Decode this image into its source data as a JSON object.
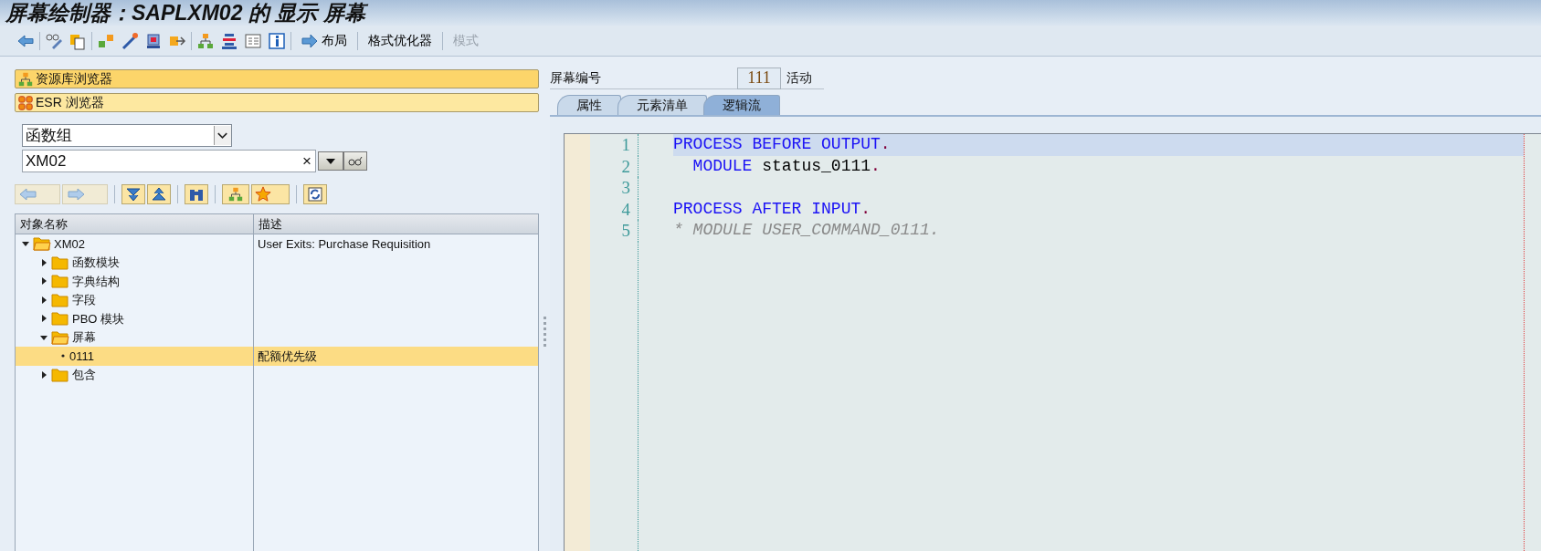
{
  "window": {
    "title": "屏幕绘制器：SAPLXM02 的 显示 屏幕"
  },
  "toolbar": {
    "buttons": [
      {
        "label": "布局",
        "disabled": false,
        "kind": "arrow"
      },
      {
        "label": "格式优化器",
        "disabled": false,
        "kind": "text"
      },
      {
        "label": "模式",
        "disabled": true,
        "kind": "text"
      }
    ]
  },
  "navigator": [
    {
      "label": "资源库浏览器",
      "selected": true,
      "kind": "hierarchy"
    },
    {
      "label": "ESR 浏览器",
      "selected": false,
      "kind": "grid"
    }
  ],
  "object_type": {
    "value": "函数组"
  },
  "object_name": {
    "value": "XM02",
    "clear": "×"
  },
  "tree": {
    "columns": [
      "对象名称",
      "描述"
    ],
    "nodes": [
      {
        "name": "XM02",
        "description": "User Exits: Purchase Requisition",
        "kind": "folder",
        "expanded": true,
        "selected": false,
        "children": [
          {
            "name": "函数模块",
            "kind": "folder",
            "expanded": false,
            "selected": false
          },
          {
            "name": "字典结构",
            "kind": "folder",
            "expanded": false,
            "selected": false
          },
          {
            "name": "字段",
            "kind": "folder",
            "expanded": false,
            "selected": false
          },
          {
            "name": "PBO 模块",
            "kind": "folder",
            "expanded": false,
            "selected": false
          },
          {
            "name": "屏幕",
            "kind": "folder",
            "expanded": true,
            "selected": false,
            "children": [
              {
                "name": "0111",
                "description": "配额优先级",
                "kind": "object",
                "selected": true
              }
            ]
          },
          {
            "name": "包含",
            "kind": "folder",
            "expanded": false,
            "selected": false
          }
        ]
      }
    ]
  },
  "screen_number": {
    "label": "屏幕编号",
    "value": "111",
    "status": "活动"
  },
  "tabs": [
    {
      "label": "属性",
      "selected": false
    },
    {
      "label": "元素清单",
      "selected": false
    },
    {
      "label": "逻辑流",
      "selected": true
    }
  ],
  "code": [
    {
      "number": "1",
      "selected": true,
      "tokens": [
        {
          "kind": "keyword",
          "text": "PROCESS BEFORE OUTPUT"
        },
        {
          "kind": "punct",
          "text": "."
        }
      ]
    },
    {
      "number": "2",
      "selected": false,
      "tokens": [
        {
          "kind": "keyword",
          "text": "  MODULE"
        },
        {
          "kind": "text",
          "text": " status_0111"
        },
        {
          "kind": "punct",
          "text": "."
        }
      ]
    },
    {
      "number": "3",
      "selected": false
    },
    {
      "number": "4",
      "selected": false,
      "tokens": [
        {
          "kind": "keyword",
          "text": "PROCESS AFTER INPUT"
        },
        {
          "kind": "punct",
          "text": "."
        }
      ]
    },
    {
      "number": "5",
      "selected": false,
      "tokens": [
        {
          "kind": "comment",
          "text": "* MODULE USER_COMMAND_0111."
        }
      ]
    }
  ]
}
